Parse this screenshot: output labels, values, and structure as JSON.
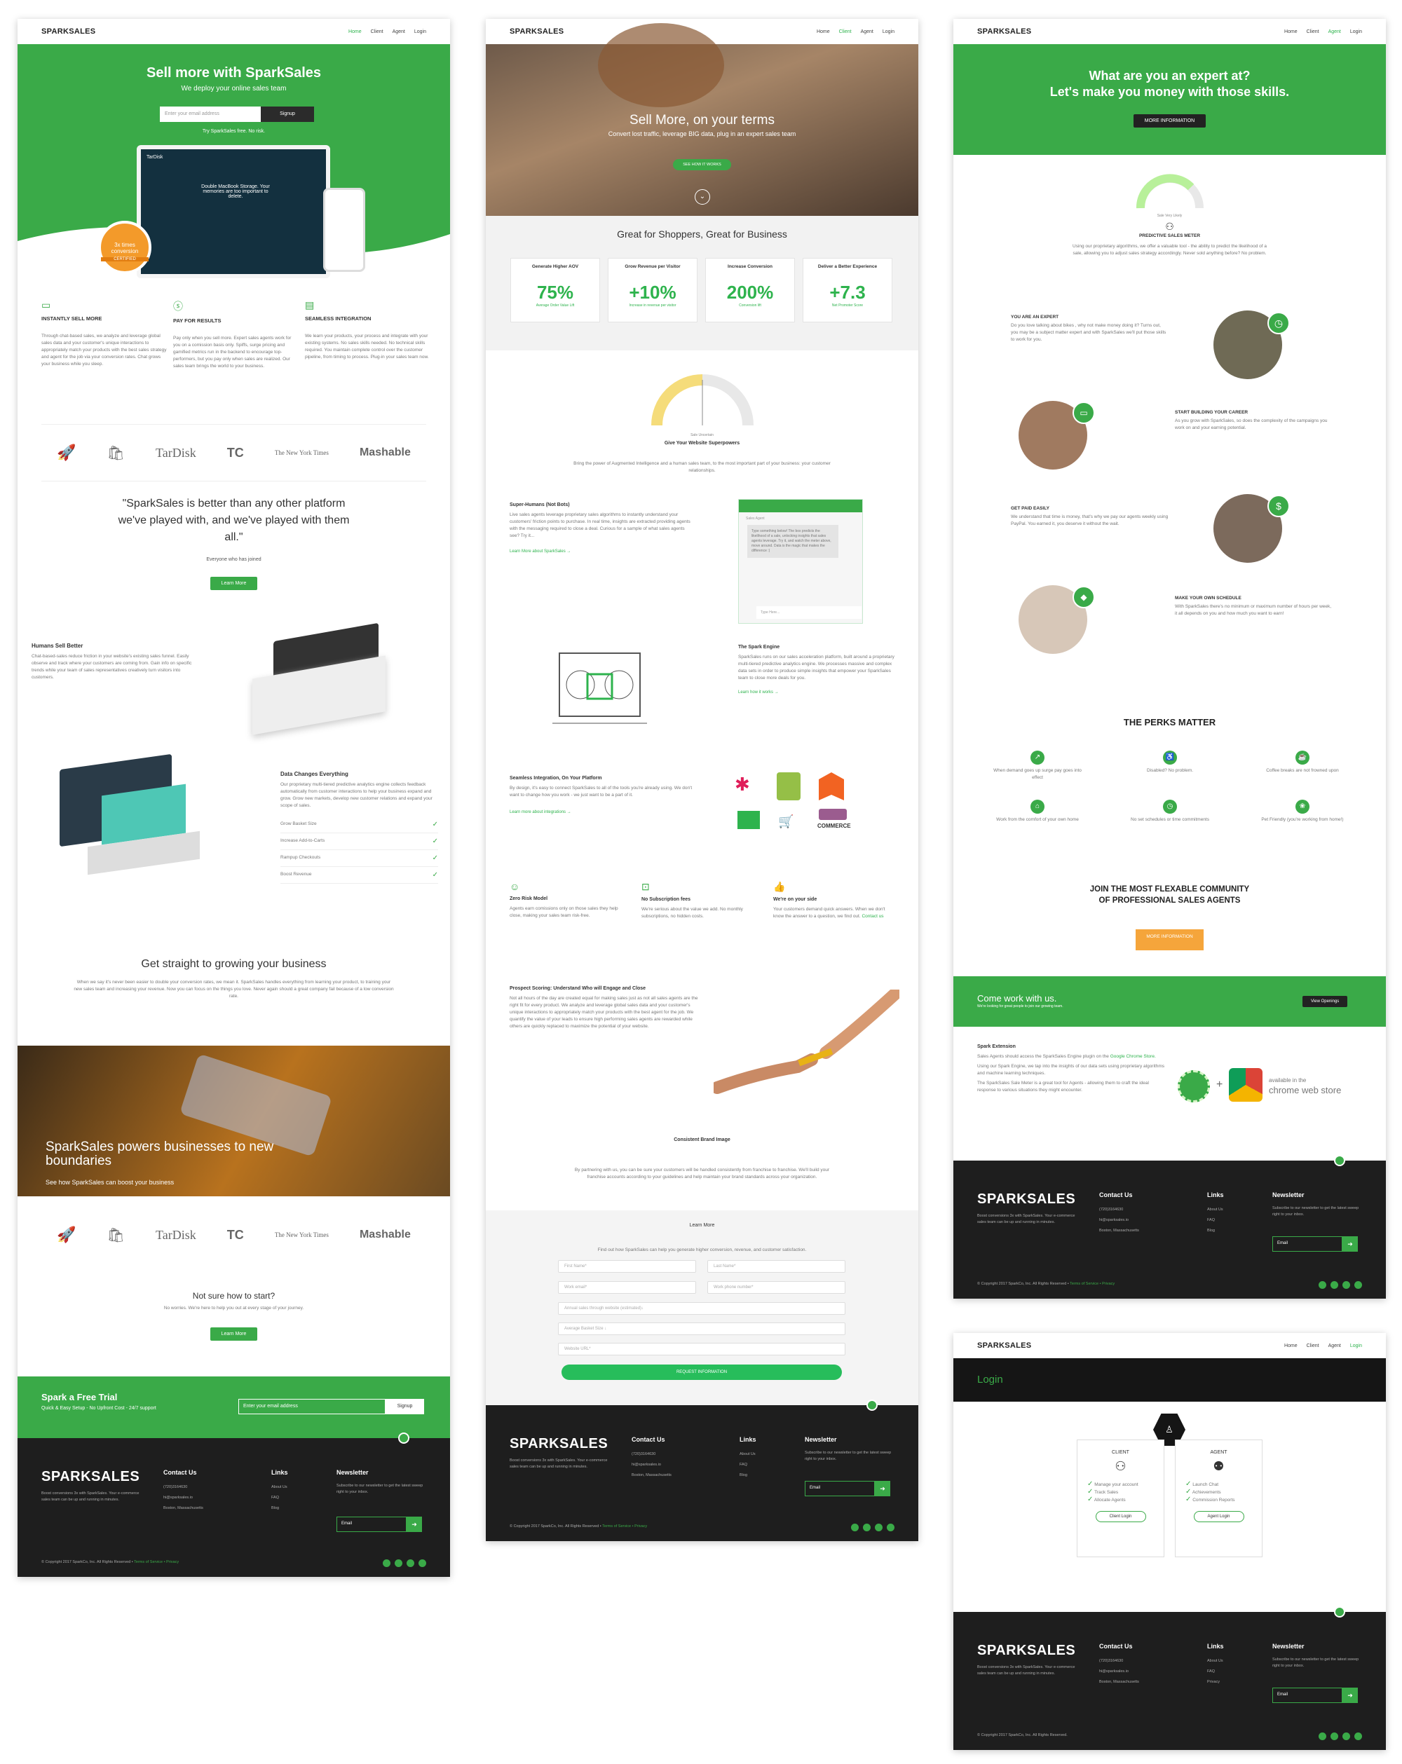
{
  "colors": {
    "brand": "#3aaa48",
    "dark": "#1e1e1e"
  },
  "nav": {
    "logo": "SPARKSALES",
    "home": "Home",
    "client": "Client",
    "agent": "Agent",
    "login": "Login"
  },
  "footer": {
    "logo": "SPARKSALES",
    "desc": "Boost conversions 3x with SparkSales. Your e-commerce sales team can be up and running in minutes.",
    "contact_title": "Contact Us",
    "phone": "(720)3164630",
    "email": "hi@sparksales.io",
    "address": "Boston, Massachusetts",
    "links_title": "Links",
    "links": [
      "About Us",
      "FAQ",
      "Blog"
    ],
    "links_alt": [
      "About Us",
      "FAQ",
      "Privacy"
    ],
    "newsletter_title": "Newsletter",
    "newsletter_text": "Subscribe to our newsletter to get the latest sweep right to your inbox.",
    "email_placeholder": "Email",
    "email_btn": "➜",
    "copyright": "© Copyright 2017 SparkCo, Inc. All Rights Reserved •",
    "terms": "Terms of Service • Privacy",
    "copyright_short": "© Copyright 2017 SparkCo, Inc. All Rights Reserved."
  },
  "p1": {
    "hero_title": "Sell more with SparkSales",
    "hero_sub": "We deploy your online sales team",
    "email_ph": "Enter your email address",
    "signup": "Signup",
    "try": "Try SparkSales free. No risk.",
    "mock_brand": "TarDisk",
    "mock_text": "Double MacBook Storage. Your memories are too important to delete.",
    "badge_1": "3x times",
    "badge_2": "conversion",
    "badge_3": "CERTIFIED",
    "f1_title": "INSTANTLY SELL MORE",
    "f1_text": "Through chat-based sales, we analyze and leverage global sales data and your customer's unique interactions to appropriately match your products with the best sales strategy and agent for the job via your conversion rates. Chat grows your business while you sleep.",
    "f2_title": "PAY FOR RESULTS",
    "f2_text": "Pay only when you sell more. Expert sales agents work for you on a comission basis only. Spiffs, surge pricing and gamified metrics run in the backend to encourage top-performers, but you pay only when sales are realized. Our sales team brings the world to your business.",
    "f3_title": "SEAMLESS INTEGRATION",
    "f3_text": "We learn your products, your process and integrate with your existing systems. No sales skills needed. No technical skills required. You maintain complete control over the customer pipeline, from timing to process. Plug-in your sales team now.",
    "logos": [
      "TarDisk",
      "TC",
      "The New York Times",
      "Mashable"
    ],
    "quote": "\"SparkSales is better than any other platform we've played with, and we've played with them all.\"",
    "quote_by": "Everyone who has joined",
    "learn_more": "Learn More",
    "h1_title": "Humans Sell Better",
    "h1_text": "Chat-based-sales reduce friction in your website's existing sales funnel. Easily observe and track where your customers are coming from. Gain info on specific trends while your team of sales representatives creatively turn visitors into customers.",
    "dc_title": "Data Changes Everything",
    "dc_text": "Our proprietary multi-tiered predictive analytics engine collects feedback automatically from customer interactions to help your business expand and grow. Grow new markets, develop new customer relations and expand your scope of sales.",
    "dc_list": [
      "Grow Basket Size",
      "Increase Add-to-Carts",
      "Rampup Checkouts",
      "Boost Revenue"
    ],
    "gs_title": "Get straight to growing your business",
    "gs_text": "When we say it's never been easier to double your conversion rates, we mean it. SparkSales handles everything from learning your product, to training your new sales team and increasing your revenue. Now you can focus on the things you love. Never again should a great company fail because of a low conversion rate.",
    "band_title": "SparkSales powers businesses to new boundaries",
    "band_sub": "See how SparkSales can boost your business",
    "ns_title": "Not sure how to start?",
    "ns_text": "No worries. We're here to help you out at every stage of your journey.",
    "trial_title": "Spark a Free Trial",
    "trial_sub": "Quick & Easy Setup - No Upfront Cost - 24/7 support",
    "trial_ph": "Enter your email address",
    "trial_btn": "Signup"
  },
  "p2": {
    "hero_title": "Sell More, on your terms",
    "hero_sub": "Convert lost traffic, leverage BIG data, plug in an expert sales team",
    "hero_btn": "SEE HOW IT WORKS",
    "great": "Great for Shoppers, Great for Business",
    "stats": [
      {
        "label": "Generate Higher AOV",
        "value": "75%",
        "sub": "Average Order Value Lift"
      },
      {
        "label": "Grow Revenue per Visitor",
        "value": "+10%",
        "sub": "Increase in revenue per visitor"
      },
      {
        "label": "Increase Conversion",
        "value": "200%",
        "sub": "Conversion lift"
      },
      {
        "label": "Deliver a Better Experience",
        "value": "+7.3",
        "sub": "Net Promoter Score"
      }
    ],
    "gauge_label": "Sale Uncertain",
    "sp_title": "Give Your Website Superpowers",
    "sp_text": "Bring the power of Augmented Intelligence and a human sales team, to the most important part of your business: your customer relationships.",
    "sh_title": "Super-Humans (Not Bots)",
    "sh_text": "Live sales agents leverage proprietary sales algorithms to instantly understand your customers' friction points to purchase. In real time, insights are extracted providing agents with the messaging required to close a deal. Curious for a sample of what sales agents see? Try it...",
    "sh_link": "Learn More about SparkSales →",
    "chat_head": "Sales Agent",
    "chat_msg": "Type something below! The box predicts the likelihood of a sale, unlocking insights that sales agents leverage. Try it, and watch the meter above, move around. Data is the magic that makes the difference :)",
    "chat_ph": "Type Here...",
    "se_title": "The Spark Engine",
    "se_text": "SparkSales runs on our sales acceleration platform, built around a proprietary multi-tiered predictive analytics engine. We processes massive and complex data sets in order to produce simple insights that empower your SparkSales team to close more deals for you.",
    "se_link": "Learn how it works →",
    "si_title": "Seamless Integration, On Your Platform",
    "si_text": "By design, it's easy to connect SparkSales to all of the tools you're already using. We don't want to change how you work - we just want to be a part of it.",
    "si_link": "Learn more about integrations →",
    "woo": "COMMERCE",
    "zr_title": "Zero Risk Model",
    "zr_text": "Agents earn comissions only on those sales they help close, making your sales team risk-free.",
    "nf_title": "No Subscription fees",
    "nf_text": "We're serious about the value we add. No monthly subscriptions, no hidden costs.",
    "os_title": "We're on your side",
    "os_text": "Your customers demand quick answers. When we don't know the answer to a question, we find out.",
    "os_link": "Contact us",
    "ps_title": "Prospect Scoring: Understand Who will Engage and Close",
    "ps_text": "Not all hours of the day are created equal for making sales just as not all sales agents are the right fit for every product. We analyze and leverage global sales data and your customer's unique interactions to appropriately match your products with the best agent for the job. We quantify the value of your leads to ensure high performing sales agents are rewarded while others are quickly replaced to maximize the potential of your website.",
    "cb_title": "Consistent Brand Image",
    "cb_text": "By partnering with us, you can be sure your customers will be handled consistently from franchise to franchise. We'll build your franchise accounts according to your guidelines and help maintain your brand standards across your organization.",
    "lm_title": "Learn More",
    "lm_text": "Find out how SparkSales can help you generate higher conversion, revenue, and customer satisfaction.",
    "form": [
      "First Name*",
      "Last Name*",
      "Work email*",
      "Work phone number*",
      "Annual sales through website (estimated)↓",
      "Average Basket Size ↓",
      "Website URL*"
    ],
    "form_btn": "REQUEST INFORMATION"
  },
  "p3": {
    "hero_l1": "What are you an expert at?",
    "hero_l2": "Let's make you money with those skills.",
    "hero_btn": "MORE INFORMATION",
    "gauge": "Sale Very Likely",
    "pm_title": "PREDICTIVE SALES METER",
    "pm_text": "Using our proprietary algorithms, we offer a valuable tool - the ability to predict the likelihood of a sale, allowing you to adjust sales strategy accordingly. Never sold anything before? No problem.",
    "e1_title": "YOU ARE AN EXPERT",
    "e1_text": "Do you love talking about bikes , why not make money doing it? Turns out, you may be a subject matter expert and with SparkSales we'll put those skills to work for you.",
    "e2_title": "START BUILDING YOUR CAREER",
    "e2_text": "As you grow with SparkSales, so does the complexity of the campaigns you work on and your earning potential.",
    "e3_title": "GET PAID EASILY",
    "e3_text": "We understand that time is money, that's why we pay our agents weekly using PayPal. You earned it, you deserve it without the wait.",
    "e4_title": "MAKE YOUR OWN SCHEDULE",
    "e4_text": "With SparkSales there's no minimum or maximum number of hours per week, it all depends on you and how much you want to earn!",
    "perks_title": "THE PERKS MATTER",
    "perks": [
      "When demand goes up surge pay goes into effect",
      "Disabled? No problem.",
      "Coffee breaks are not frowned upon",
      "Work from the comfort of your own home",
      "No set schedules or time commitments",
      "Pet Friendly (you're working from home!)"
    ],
    "join_l1": "JOIN THE MOST FLEXABLE COMMUNITY",
    "join_l2": "OF PROFESSIONAL SALES AGENTS",
    "join_btn": "MORE INFORMATION",
    "cw_title": "Come work with us.",
    "cw_sub": "We're looking for great people to join our growing team.",
    "cw_btn": "View Openings",
    "ext_title": "Spark Extension",
    "ext_t1": "Sales Agents should access the SparkSales Engine plugin on the",
    "ext_link": "Google Chrome Store.",
    "ext_t2": "Using our Spark Engine, we tap into the insights of our data sets using proprietary algorithms and machine learning techniques.",
    "ext_t3": "The SparkSales Sale Meter is a great tool for Agents - allowing them to craft the ideal response to various situations they might encounter.",
    "avail": "available in the",
    "cws": "chrome web store"
  },
  "p4": {
    "login": "Login",
    "client": "CLIENT",
    "agent": "AGENT",
    "client_list": [
      "Manage your account",
      "Track Sales",
      "Allocate Agents"
    ],
    "agent_list": [
      "Launch Chat",
      "Achievements",
      "Commission Reports"
    ],
    "client_btn": "Client Login",
    "agent_btn": "Agent Login"
  }
}
